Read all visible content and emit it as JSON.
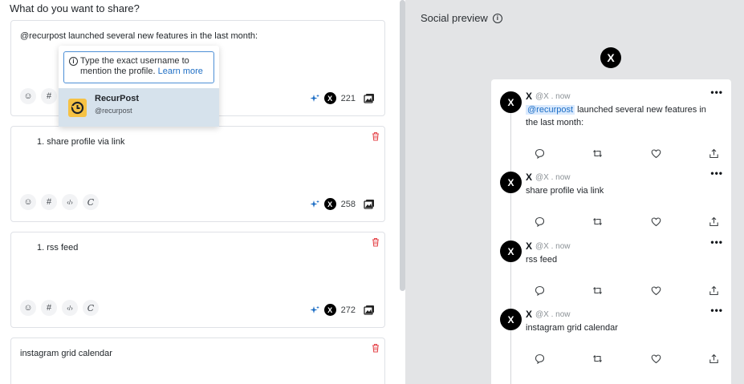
{
  "composer": {
    "heading": "What do you want to share?",
    "cards": [
      {
        "text": "@recurpost launched several new features in the last month:",
        "count": "221",
        "numbered": false
      },
      {
        "text": "1. share profile via link",
        "count": "258",
        "numbered": true
      },
      {
        "text": "1. rss feed",
        "count": "272",
        "numbered": true
      },
      {
        "text": "instagram grid calendar",
        "count": "",
        "numbered": false
      }
    ],
    "toolbar_icons": [
      "emoji-icon",
      "hashtag-icon",
      "code-icon",
      "signature-icon"
    ]
  },
  "mention_popup": {
    "hint": "Type the exact username to mention the profile.",
    "learn_more": "Learn more",
    "suggestion_name": "RecurPost",
    "suggestion_handle": "@recurpost"
  },
  "preview": {
    "title": "Social preview",
    "network_icon": "x-logo-icon",
    "tweets": [
      {
        "name": "X",
        "meta": "@X . now",
        "mention": "@recurpost",
        "body": " launched several new features in the last month:"
      },
      {
        "name": "X",
        "meta": "@X . now",
        "mention": "",
        "body": "share profile via link"
      },
      {
        "name": "X",
        "meta": "@X . now",
        "mention": "",
        "body": "rss feed"
      },
      {
        "name": "X",
        "meta": "@X . now",
        "mention": "",
        "body": "instagram grid calendar"
      }
    ],
    "more_label": "•••",
    "action_icons": [
      "reply-icon",
      "retweet-icon",
      "like-icon",
      "share-icon"
    ]
  },
  "colors": {
    "accent": "#1f6fc5",
    "delete": "#e5484d",
    "preview_bg": "#e3e4e6"
  }
}
